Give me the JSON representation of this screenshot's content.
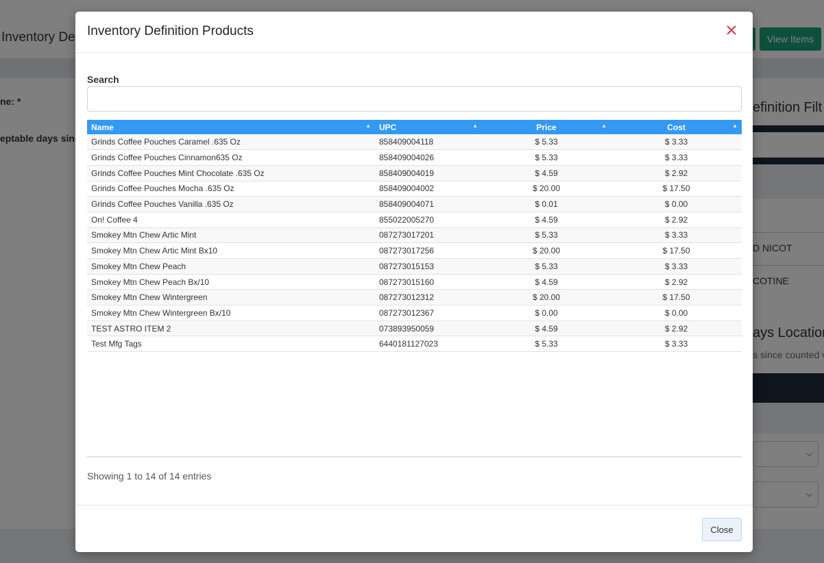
{
  "background": {
    "page_title": "Inventory De",
    "header_buttons": {
      "view_items": "View Items"
    },
    "labels": {
      "name_label": "ne: *",
      "days_label": "eptable days since"
    },
    "side_panel": {
      "title": "efinition Filt",
      "rows": [
        "D NICOT",
        "COTINE"
      ],
      "section_title": "ays Location",
      "section_sub": "s since counted v"
    }
  },
  "modal": {
    "title": "Inventory Definition Products",
    "search": {
      "label": "Search",
      "value": "",
      "placeholder": ""
    },
    "table": {
      "columns": [
        "Name",
        "UPC",
        "Price",
        "Cost"
      ],
      "rows": [
        {
          "name": "Grinds Coffee Pouches Caramel .635 Oz",
          "upc": "858409004118",
          "price": "$ 5.33",
          "cost": "$ 3.33"
        },
        {
          "name": "Grinds Coffee Pouches Cinnamon635 Oz",
          "upc": "858409004026",
          "price": "$ 5.33",
          "cost": "$ 3.33"
        },
        {
          "name": "Grinds Coffee Pouches Mint Chocolate .635 Oz",
          "upc": "858409004019",
          "price": "$ 4.59",
          "cost": "$ 2.92"
        },
        {
          "name": "Grinds Coffee Pouches Mocha .635 Oz",
          "upc": "858409004002",
          "price": "$ 20.00",
          "cost": "$ 17.50"
        },
        {
          "name": "Grinds Coffee Pouches Vanilla .635 Oz",
          "upc": "858409004071",
          "price": "$ 0.01",
          "cost": "$ 0.00"
        },
        {
          "name": "On! Coffee 4",
          "upc": "855022005270",
          "price": "$ 4.59",
          "cost": "$ 2.92"
        },
        {
          "name": "Smokey Mtn Chew Artic Mint",
          "upc": "087273017201",
          "price": "$ 5.33",
          "cost": "$ 3.33"
        },
        {
          "name": "Smokey Mtn Chew Artic Mint Bx10",
          "upc": "087273017256",
          "price": "$ 20.00",
          "cost": "$ 17.50"
        },
        {
          "name": "Smokey Mtn Chew Peach",
          "upc": "087273015153",
          "price": "$ 5.33",
          "cost": "$ 3.33"
        },
        {
          "name": "Smokey Mtn Chew Peach Bx/10",
          "upc": "087273015160",
          "price": "$ 4.59",
          "cost": "$ 2.92"
        },
        {
          "name": "Smokey Mtn Chew Wintergreen",
          "upc": "087273012312",
          "price": "$ 20.00",
          "cost": "$ 17.50"
        },
        {
          "name": "Smokey Mtn Chew Wintergreen Bx/10",
          "upc": "087273012367",
          "price": "$ 0.00",
          "cost": "$ 0.00"
        },
        {
          "name": "TEST ASTRO ITEM 2",
          "upc": "073893950059",
          "price": "$ 4.59",
          "cost": "$ 2.92"
        },
        {
          "name": "Test Mfg Tags",
          "upc": "6440181127023",
          "price": "$ 5.33",
          "cost": "$ 3.33"
        }
      ]
    },
    "info_text": "Showing 1 to 14 of 14 entries",
    "close_button": "Close"
  },
  "colors": {
    "table_header": "#3399f3",
    "close_icon": "#dc3545",
    "header_button": "#1aa37a"
  },
  "icons": {
    "close": "close-icon",
    "sort": "sort-icon",
    "sort_asc": "sort-asc-icon",
    "select_chevron": "chevron-down-icon"
  }
}
